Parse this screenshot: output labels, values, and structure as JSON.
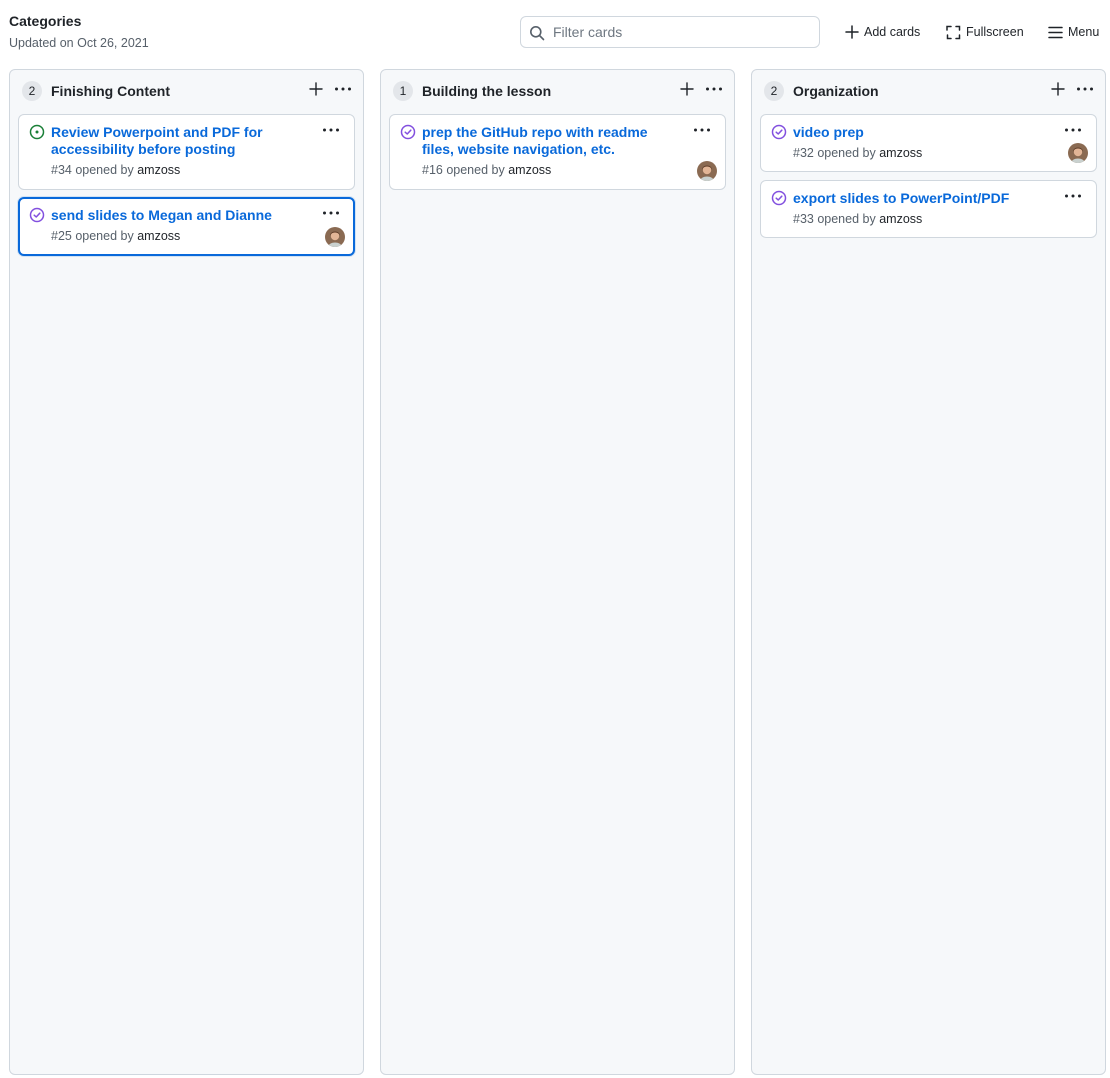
{
  "header": {
    "title": "Categories",
    "updated": "Updated on Oct 26, 2021",
    "search_placeholder": "Filter cards",
    "add_cards_label": "Add cards",
    "fullscreen_label": "Fullscreen",
    "menu_label": "Menu"
  },
  "columns": [
    {
      "count": "2",
      "name": "Finishing Content",
      "cards": [
        {
          "title": "Review Powerpoint and PDF for accessibility before posting",
          "meta_prefix": "#34 opened by ",
          "user": "amzoss",
          "status": "open",
          "has_avatar": false
        },
        {
          "title": "send slides to Megan and Dianne",
          "meta_prefix": "#25 opened by ",
          "user": "amzoss",
          "status": "closed",
          "has_avatar": true
        }
      ]
    },
    {
      "count": "1",
      "name": "Building the lesson",
      "cards": [
        {
          "title": "prep the GitHub repo with readme files, website navigation, etc.",
          "meta_prefix": "#16 opened by ",
          "user": "amzoss",
          "status": "closed",
          "has_avatar": true
        }
      ]
    },
    {
      "count": "2",
      "name": "Organization",
      "cards": [
        {
          "title": "video prep",
          "meta_prefix": "#32 opened by ",
          "user": "amzoss",
          "status": "closed",
          "has_avatar": true
        },
        {
          "title": "export slides to PowerPoint/PDF",
          "meta_prefix": "#33 opened by ",
          "user": "amzoss",
          "status": "closed",
          "has_avatar": false
        }
      ]
    }
  ],
  "colors": {
    "link": "#0969da",
    "open_icon": "#1a7f37",
    "closed_icon": "#8250df",
    "column_bg": "#f6f8fa",
    "border": "#d0d7de"
  },
  "icons": {
    "search": "search-icon",
    "add": "plus-icon",
    "fullscreen": "fullscreen-icon",
    "menu": "hamburger-menu-icon",
    "more": "kebab-horizontal-icon",
    "issue_open": "issue-opened-icon",
    "issue_closed": "issue-closed-icon"
  }
}
